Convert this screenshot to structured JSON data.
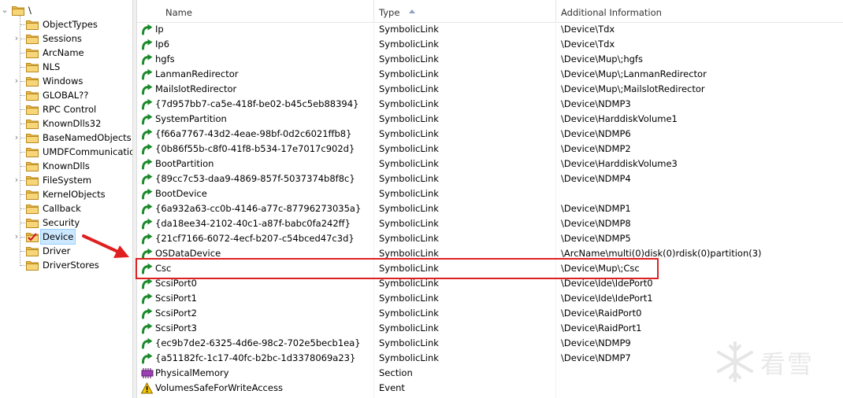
{
  "tree": {
    "root_label": "\\",
    "items": [
      {
        "label": "ObjectTypes",
        "expandable": false
      },
      {
        "label": "Sessions",
        "expandable": true
      },
      {
        "label": "ArcName",
        "expandable": false
      },
      {
        "label": "NLS",
        "expandable": false
      },
      {
        "label": "Windows",
        "expandable": true
      },
      {
        "label": "GLOBAL??",
        "expandable": false
      },
      {
        "label": "RPC Control",
        "expandable": false
      },
      {
        "label": "KnownDlls32",
        "expandable": false
      },
      {
        "label": "BaseNamedObjects",
        "expandable": true
      },
      {
        "label": "UMDFCommunicatio",
        "expandable": false
      },
      {
        "label": "KnownDlls",
        "expandable": false
      },
      {
        "label": "FileSystem",
        "expandable": true
      },
      {
        "label": "KernelObjects",
        "expandable": false
      },
      {
        "label": "Callback",
        "expandable": false
      },
      {
        "label": "Security",
        "expandable": false
      },
      {
        "label": "Device",
        "expandable": true,
        "selected": true
      },
      {
        "label": "Driver",
        "expandable": false
      },
      {
        "label": "DriverStores",
        "expandable": false
      }
    ]
  },
  "list": {
    "columns": [
      "Name",
      "Type",
      "Additional Information"
    ],
    "sorted_column": "Type",
    "rows": [
      {
        "name": "Ip",
        "type": "SymbolicLink",
        "info": "\\Device\\Tdx",
        "icon": "symlink-icon"
      },
      {
        "name": "Ip6",
        "type": "SymbolicLink",
        "info": "\\Device\\Tdx",
        "icon": "symlink-icon"
      },
      {
        "name": "hgfs",
        "type": "SymbolicLink",
        "info": "\\Device\\Mup\\;hgfs",
        "icon": "symlink-icon"
      },
      {
        "name": "LanmanRedirector",
        "type": "SymbolicLink",
        "info": "\\Device\\Mup\\;LanmanRedirector",
        "icon": "symlink-icon"
      },
      {
        "name": "MailslotRedirector",
        "type": "SymbolicLink",
        "info": "\\Device\\Mup\\;MailslotRedirector",
        "icon": "symlink-icon"
      },
      {
        "name": "{7d957bb7-ca5e-418f-be02-b45c5eb88394}",
        "type": "SymbolicLink",
        "info": "\\Device\\NDMP3",
        "icon": "symlink-icon"
      },
      {
        "name": "SystemPartition",
        "type": "SymbolicLink",
        "info": "\\Device\\HarddiskVolume1",
        "icon": "symlink-icon"
      },
      {
        "name": "{f66a7767-43d2-4eae-98bf-0d2c6021ffb8}",
        "type": "SymbolicLink",
        "info": "\\Device\\NDMP6",
        "icon": "symlink-icon"
      },
      {
        "name": "{0b86f55b-c8f0-41f8-b534-17e7017c902d}",
        "type": "SymbolicLink",
        "info": "\\Device\\NDMP2",
        "icon": "symlink-icon"
      },
      {
        "name": "BootPartition",
        "type": "SymbolicLink",
        "info": "\\Device\\HarddiskVolume3",
        "icon": "symlink-icon"
      },
      {
        "name": "{89cc7c53-daa9-4869-857f-5037374b8f8c}",
        "type": "SymbolicLink",
        "info": "\\Device\\NDMP4",
        "icon": "symlink-icon"
      },
      {
        "name": "BootDevice",
        "type": "SymbolicLink",
        "info": "",
        "icon": "symlink-icon"
      },
      {
        "name": "{6a932a63-cc0b-4146-a77c-87796273035a}",
        "type": "SymbolicLink",
        "info": "\\Device\\NDMP1",
        "icon": "symlink-icon"
      },
      {
        "name": "{da18ee34-2102-40c1-a87f-babc0fa242ff}",
        "type": "SymbolicLink",
        "info": "\\Device\\NDMP8",
        "icon": "symlink-icon"
      },
      {
        "name": "{21cf7166-6072-4ecf-b207-c54bced47c3d}",
        "type": "SymbolicLink",
        "info": "\\Device\\NDMP5",
        "icon": "symlink-icon"
      },
      {
        "name": "OSDataDevice",
        "type": "SymbolicLink",
        "info": "\\ArcName\\multi(0)disk(0)rdisk(0)partition(3)",
        "icon": "symlink-icon"
      },
      {
        "name": "Csc",
        "type": "SymbolicLink",
        "info": "\\Device\\Mup\\;Csc",
        "icon": "symlink-icon",
        "highlighted": true
      },
      {
        "name": "ScsiPort0",
        "type": "SymbolicLink",
        "info": "\\Device\\Ide\\IdePort0",
        "icon": "symlink-icon"
      },
      {
        "name": "ScsiPort1",
        "type": "SymbolicLink",
        "info": "\\Device\\Ide\\IdePort1",
        "icon": "symlink-icon"
      },
      {
        "name": "ScsiPort2",
        "type": "SymbolicLink",
        "info": "\\Device\\RaidPort0",
        "icon": "symlink-icon"
      },
      {
        "name": "ScsiPort3",
        "type": "SymbolicLink",
        "info": "\\Device\\RaidPort1",
        "icon": "symlink-icon"
      },
      {
        "name": "{ec9b7de2-6325-4d6e-98c2-702e5becb1ea}",
        "type": "SymbolicLink",
        "info": "\\Device\\NDMP9",
        "icon": "symlink-icon"
      },
      {
        "name": "{a51182fc-1c17-40fc-b2bc-1d3378069a23}",
        "type": "SymbolicLink",
        "info": "\\Device\\NDMP7",
        "icon": "symlink-icon"
      },
      {
        "name": "PhysicalMemory",
        "type": "Section",
        "info": "",
        "icon": "memory-chip-icon"
      },
      {
        "name": "VolumesSafeForWriteAccess",
        "type": "Event",
        "info": "",
        "icon": "warning-icon"
      }
    ]
  },
  "colors": {
    "highlight_box": "#e02020",
    "arrow": "#e02020",
    "selection": "#cce8ff",
    "symlink_green": "#1a8a2a"
  },
  "watermark": {
    "text": "看雪",
    "icon": "snowflake-icon"
  }
}
